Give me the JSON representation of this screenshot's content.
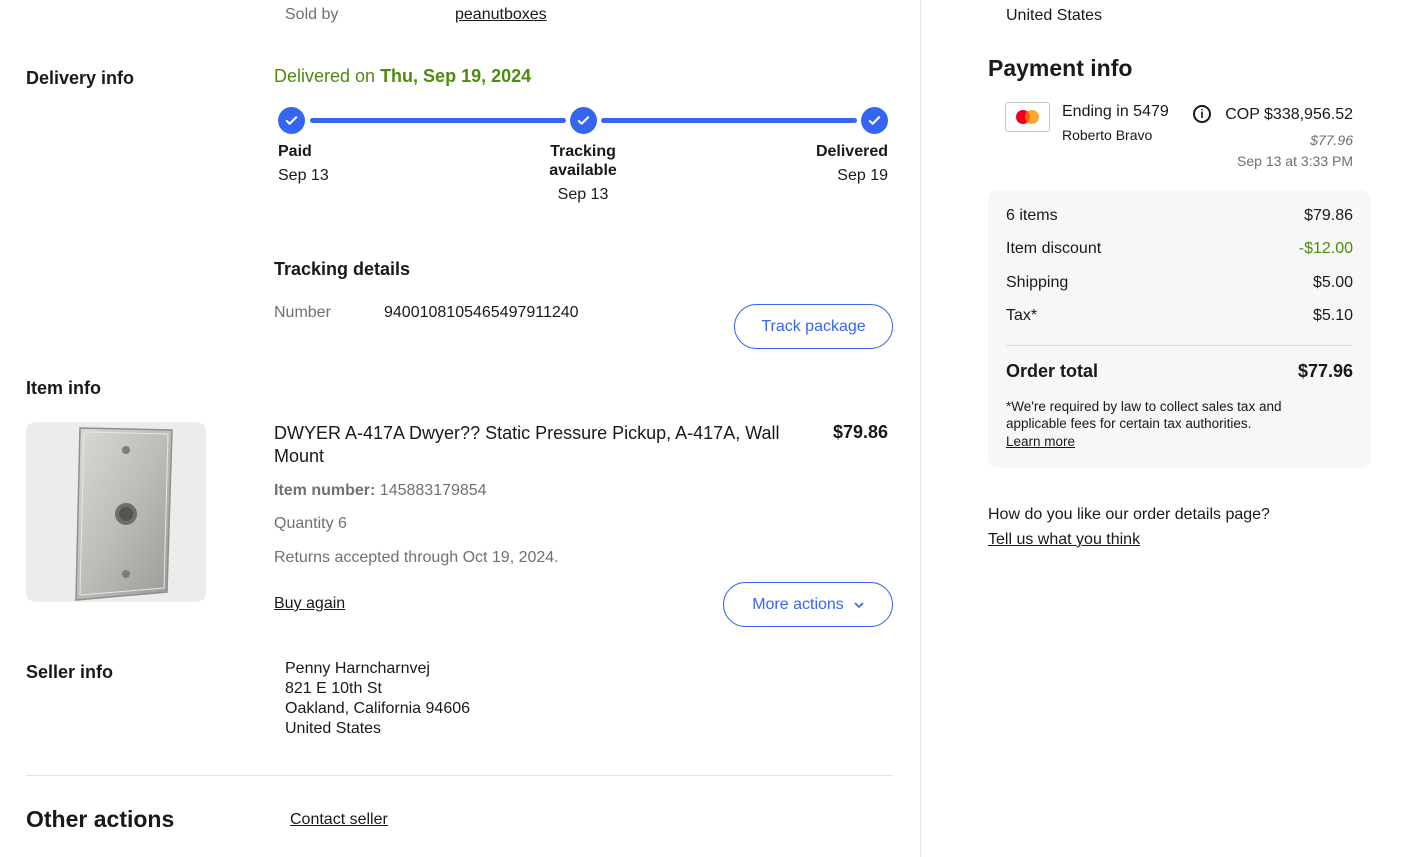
{
  "sold_by": {
    "label": "Sold by",
    "seller": "peanutboxes"
  },
  "delivery": {
    "section_label": "Delivery info",
    "status_prefix": "Delivered on ",
    "status_date": "Thu, Sep 19, 2024",
    "steps": [
      {
        "title": "Paid",
        "date": "Sep 13"
      },
      {
        "title_line1": "Tracking",
        "title_line2": "available",
        "date": "Sep 13"
      },
      {
        "title": "Delivered",
        "date": "Sep 19"
      }
    ],
    "tracking_heading": "Tracking details",
    "number_label": "Number",
    "number_value": "9400108105465497911240",
    "track_button": "Track package"
  },
  "item": {
    "section_label": "Item info",
    "title": "DWYER A-417A Dwyer?? Static Pressure Pickup, A-417A, Wall Mount",
    "price": "$79.86",
    "item_number_label": "Item number:",
    "item_number_value": "145883179854",
    "quantity": "Quantity 6",
    "returns": "Returns accepted through Oct 19, 2024.",
    "buy_again": "Buy again",
    "more_actions": "More actions"
  },
  "seller": {
    "section_label": "Seller info",
    "name": "Penny Harncharnvej",
    "address1": "821 E 10th St",
    "address2": "Oakland, California 94606",
    "country": "United States"
  },
  "other_actions": {
    "heading": "Other actions",
    "contact_seller": "Contact seller"
  },
  "ship_country": "United States",
  "payment": {
    "heading": "Payment info",
    "card_ending": "Ending in 5479",
    "card_holder": "Roberto Bravo",
    "cop_amount": "COP $338,956.52",
    "usd_amount": "$77.96",
    "paid_time": "Sep 13 at 3:33 PM"
  },
  "summary": {
    "items_label": "6 items",
    "items_value": "$79.86",
    "discount_label": "Item discount",
    "discount_value": "-$12.00",
    "shipping_label": "Shipping",
    "shipping_value": "$5.00",
    "tax_label": "Tax*",
    "tax_value": "$5.10",
    "total_label": "Order total",
    "total_value": "$77.96",
    "disclaimer": "*We're required by law to collect sales tax and applicable fees for certain tax authorities.",
    "learn_more": "Learn more"
  },
  "feedback": {
    "question": "How do you like our order details page?",
    "link": "Tell us what you think"
  },
  "colors": {
    "accent": "#3665f3",
    "success": "#4d8a0e",
    "muted": "#707070",
    "divider": "#e5e5e5"
  }
}
